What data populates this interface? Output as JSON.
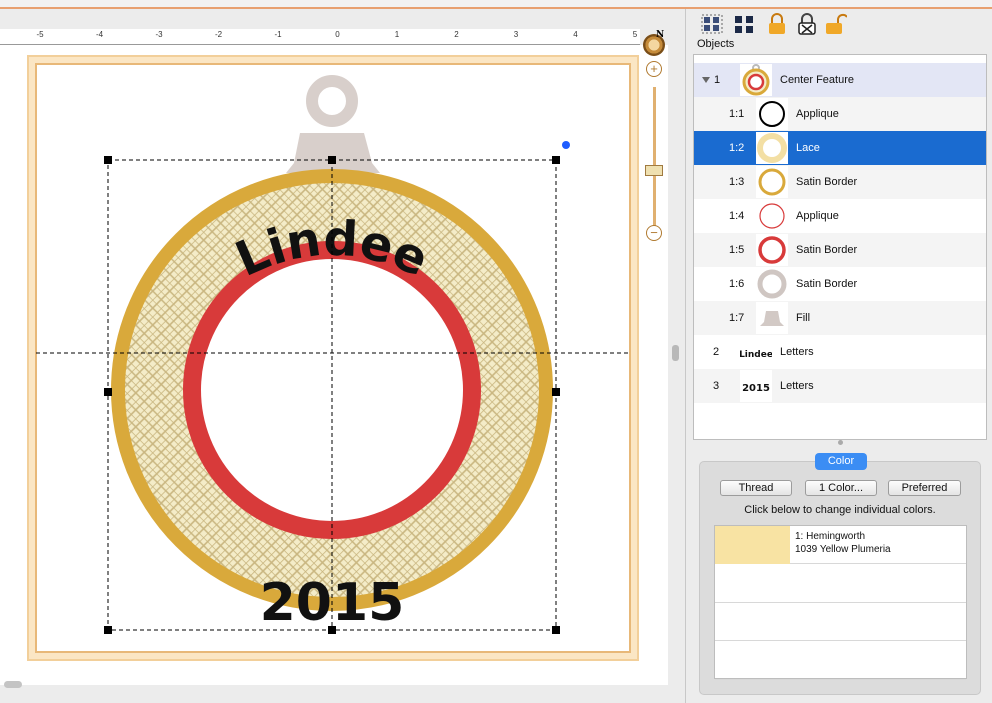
{
  "ruler": {
    "ticks": [
      "-5",
      "-4",
      "-3",
      "-2",
      "-1",
      "0",
      "1",
      "2",
      "3",
      "4",
      "5"
    ]
  },
  "canvas": {
    "design_text_top": "Lindee",
    "design_text_bottom": "2015",
    "colors": {
      "gold": "#d9a93b",
      "red": "#d83a3a",
      "lace": "#e9d9a4",
      "hanger": "#d8cfcb",
      "text": "#111111"
    }
  },
  "zoom": {
    "compass_label": "N",
    "zoom_in": "+",
    "zoom_out": "−"
  },
  "toolbar": {
    "icons": [
      "group-icon",
      "ungroup-icon",
      "lock-icon",
      "lock-remove-icon",
      "unlock-icon"
    ]
  },
  "objects": {
    "title": "Objects",
    "rows": [
      {
        "num": "1",
        "label": "Center Feature",
        "thumb": "ornament"
      },
      {
        "num": "1:1",
        "label": "Applique",
        "thumb": "ring-black"
      },
      {
        "num": "1:2",
        "label": "Lace",
        "thumb": "ring-lace"
      },
      {
        "num": "1:3",
        "label": "Satin Border",
        "thumb": "ring-gold"
      },
      {
        "num": "1:4",
        "label": "Applique",
        "thumb": "ring-red-thin"
      },
      {
        "num": "1:5",
        "label": "Satin Border",
        "thumb": "ring-red"
      },
      {
        "num": "1:6",
        "label": "Satin Border",
        "thumb": "ring-grey"
      },
      {
        "num": "1:7",
        "label": "Fill",
        "thumb": "bell"
      },
      {
        "num": "2",
        "label": "Letters",
        "thumb": "text-lindee"
      },
      {
        "num": "3",
        "label": "Letters",
        "thumb": "text-2015"
      }
    ],
    "selected_index": 2
  },
  "color_panel": {
    "tab_label": "Color",
    "thread_button": "Thread",
    "one_color_button": "1 Color...",
    "preferred_button": "Preferred",
    "hint": "Click below to change individual colors.",
    "threads": [
      {
        "line1": "1: Hemingworth",
        "line2": "1039 Yellow Plumeria",
        "color": "#f8e3a3"
      }
    ]
  }
}
